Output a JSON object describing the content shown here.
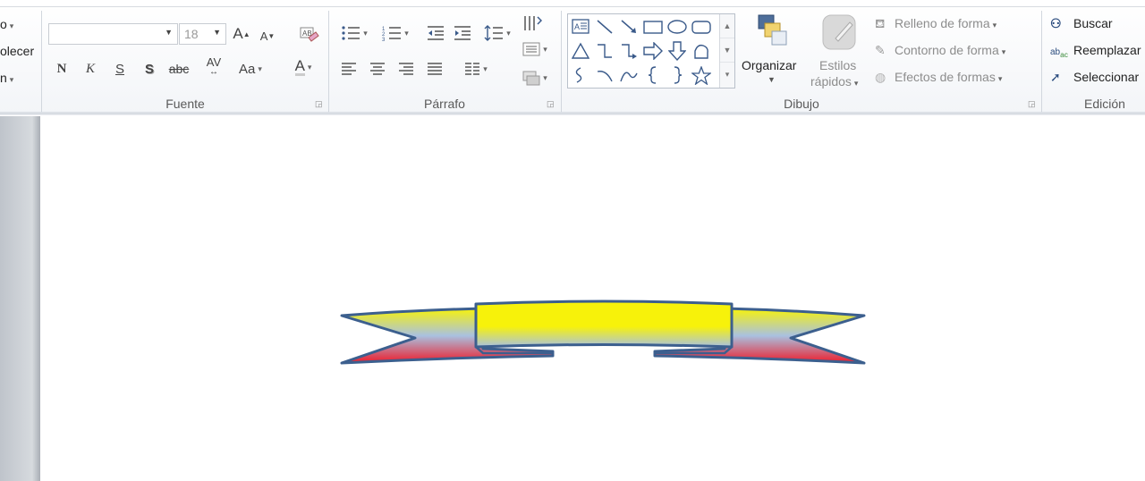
{
  "ribbon": {
    "clipboard_partial": {
      "row1": "o",
      "row2": "olecer",
      "row3": "n"
    },
    "font": {
      "label": "Fuente",
      "font_name": "",
      "font_size": "18",
      "buttons": {
        "bold": "N",
        "italic": "K",
        "underline": "S",
        "shadow": "S",
        "strikethrough": "abc",
        "spacing": "AV",
        "case": "Aa",
        "grow": "A",
        "shrink": "A",
        "color": "A"
      }
    },
    "paragraph": {
      "label": "Párrafo"
    },
    "drawing": {
      "label": "Dibujo",
      "arrange_label": "Organizar",
      "quick_styles_label1": "Estilos",
      "quick_styles_label2": "rápidos",
      "shape_fill": "Relleno de forma",
      "shape_outline": "Contorno de forma",
      "shape_effects": "Efectos de formas"
    },
    "editing": {
      "label": "Edición",
      "find": "Buscar",
      "replace": "Reemplazar",
      "select": "Seleccionar"
    }
  },
  "document": {
    "shape": "ribbon-banner",
    "fill_colors": [
      "#f7f20a",
      "#a9c1e0",
      "#ee1c2a"
    ],
    "outline_color": "#3c5f8e"
  }
}
